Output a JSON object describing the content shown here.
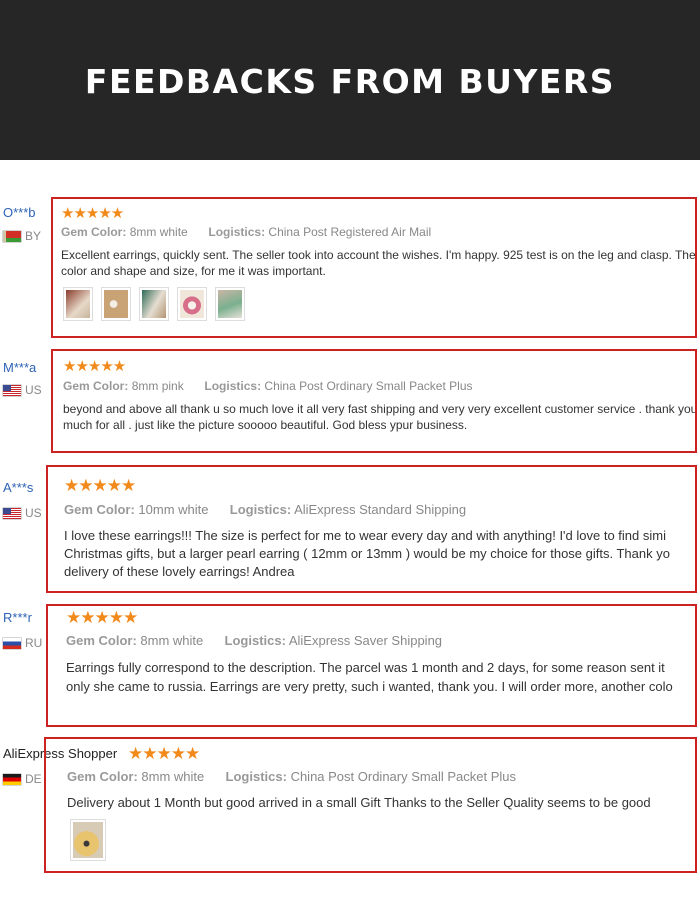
{
  "header": {
    "title": "FEEDBACKS FROM BUYERS"
  },
  "labels": {
    "gem_color": "Gem Color:",
    "logistics": "Logistics:"
  },
  "reviews": [
    {
      "buyer": "O***b",
      "country": "BY",
      "stars": "★★★★★",
      "gem_color": "8mm white",
      "logistics": "China Post Registered Air Mail",
      "text_lines": [
        "Excellent earrings, quickly sent. The seller took into account the wishes. I'm happy. 925 test is on the leg and clasp. The",
        "color and shape and size, for me it was important."
      ],
      "photos": 5
    },
    {
      "buyer": "M***a",
      "country": "US",
      "stars": "★★★★★",
      "gem_color": "8mm pink",
      "logistics": "China Post Ordinary Small Packet Plus",
      "text_lines": [
        "beyond and above all thank u so much love it all very fast shipping and very very excellent customer service . thank you",
        "much for all . just like the picture sooooo beautiful. God bless ypur business."
      ],
      "photos": 0
    },
    {
      "buyer": "A***s",
      "country": "US",
      "stars": "★★★★★",
      "gem_color": "10mm white",
      "logistics": "AliExpress Standard Shipping",
      "text_lines": [
        "I love these earrings!!! The size is perfect for me to wear every day and with anything! I'd love to find simi",
        "Christmas gifts, but a larger pearl earring ( 12mm or 13mm ) would be my choice for those gifts. Thank yo",
        "delivery of these lovely earrings! Andrea"
      ],
      "photos": 0
    },
    {
      "buyer": "R***r",
      "country": "RU",
      "stars": "★★★★★",
      "gem_color": "8mm white",
      "logistics": "AliExpress Saver Shipping",
      "text_lines": [
        "Earrings fully correspond to the description. The parcel was 1 month and 2 days, for some reason sent it",
        "only she came to russia. Earrings are very pretty, such i wanted, thank you. I will order more, another colo"
      ],
      "photos": 0
    },
    {
      "buyer": "AliExpress Shopper",
      "country": "DE",
      "stars": "★★★★★",
      "gem_color": "8mm white",
      "logistics": "China Post Ordinary Small Packet Plus",
      "text_lines": [
        "Delivery about 1 Month but good arrived in a small Gift Thanks to the Seller Quality seems to be good"
      ],
      "photos": 1
    }
  ],
  "colors": {
    "accent_border": "#cc2222",
    "star": "#f28a1b",
    "buyer_link": "#2e63b5",
    "header_bg": "#262626"
  }
}
